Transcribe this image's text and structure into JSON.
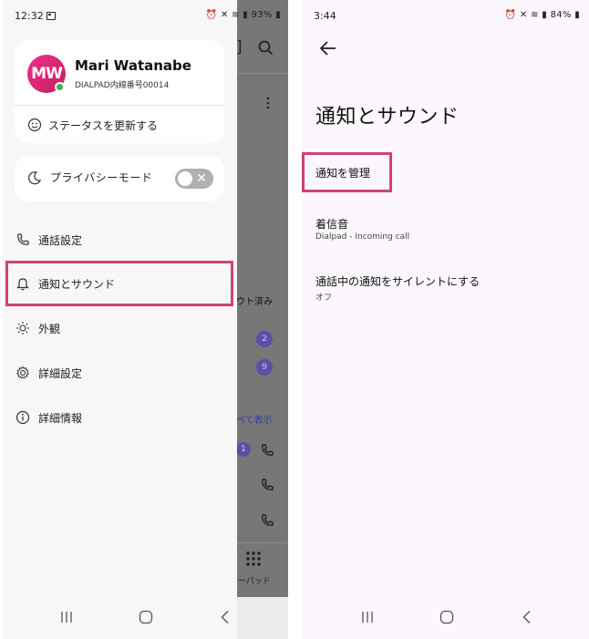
{
  "left": {
    "status": {
      "time": "12:32",
      "battery": "93%"
    },
    "profile": {
      "initials": "MW",
      "name": "Mari Watanabe",
      "extension": "DIALPAD内線番号00014",
      "status_update_label": "ステータスを更新する"
    },
    "privacy": {
      "label": "プライバシーモード",
      "enabled": false
    },
    "menu": [
      {
        "label": "通話設定",
        "icon": "phone-icon"
      },
      {
        "label": "通知とサウンド",
        "icon": "bell-icon",
        "highlighted": true
      },
      {
        "label": "外観",
        "icon": "sun-icon"
      },
      {
        "label": "詳細設定",
        "icon": "gear-icon"
      },
      {
        "label": "詳細情報",
        "icon": "info-icon"
      }
    ],
    "background": {
      "logout_fragment": "ウト済み",
      "badges": [
        "2",
        "9",
        "1"
      ],
      "show_all_fragment": "べて表示",
      "dialpad_fragment": "ーパッド"
    }
  },
  "right": {
    "status": {
      "time": "3:44",
      "battery": "84%"
    },
    "title": "通知とサウンド",
    "settings": [
      {
        "title": "通知を管理",
        "subtitle": "",
        "highlighted": true
      },
      {
        "title": "着信音",
        "subtitle": "Dialpad - Incoming call"
      },
      {
        "title": "通話中の通知をサイレントにする",
        "subtitle": "オフ"
      }
    ]
  },
  "colors": {
    "highlight": "#d0407a",
    "avatar": "#e22a7c",
    "presence": "#3bb54a",
    "badge": "#5a50a8"
  }
}
